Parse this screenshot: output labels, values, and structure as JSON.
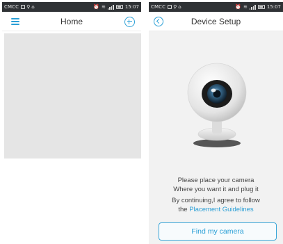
{
  "status_bar": {
    "carrier": "CMCC",
    "time": "15:07",
    "icons": [
      "sim-icon",
      "usb-icon",
      "alarm-icon",
      "wifi-icon",
      "signal-icon",
      "battery-icon"
    ]
  },
  "home_screen": {
    "title": "Home",
    "menu_icon": "menu-icon",
    "add_icon": "add-circle-icon"
  },
  "setup_screen": {
    "title": "Device Setup",
    "back_icon": "back-circle-icon",
    "illustration": "webcam-icon",
    "message_line1": "Please place your camera",
    "message_line2": "Where you want it and plug it",
    "agree_line": "By continuing,I agree to follow",
    "agree_prefix": "the ",
    "guidelines_link": "Placement Guidelines",
    "find_button": "Find my camera"
  },
  "colors": {
    "accent": "#2a9fd6",
    "status_bar": "#2f3235",
    "content_placeholder": "#e5e5e5",
    "setup_background": "#f2f2f2"
  }
}
